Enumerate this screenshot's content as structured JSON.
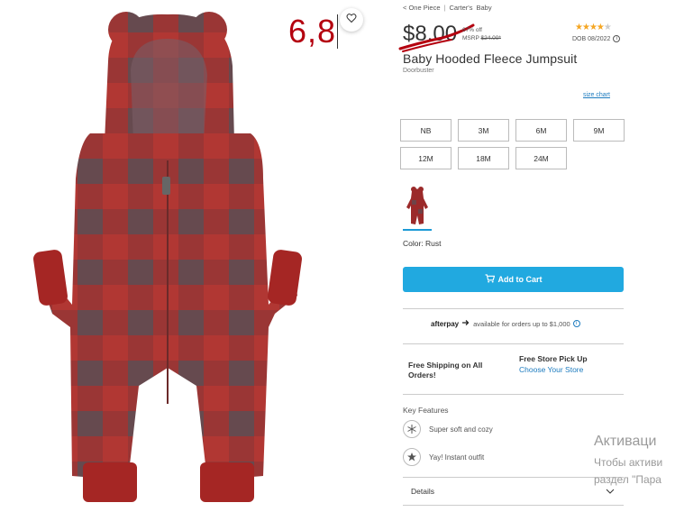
{
  "breadcrumb": [
    "< One Piece",
    "Carter's",
    "Baby"
  ],
  "annotation": {
    "handwritten_price": "6,8"
  },
  "price": {
    "sale": "$8.00",
    "percent_off": "67% off",
    "msrp_label": "MSRP",
    "msrp_value": "$24.00*"
  },
  "rating": {
    "stars_value": 4,
    "stars_max": 5,
    "dob": "DOB 08/2022"
  },
  "product": {
    "title": "Baby Hooded Fleece Jumpsuit",
    "subtitle": "Doorbuster"
  },
  "size_chart_label": "size chart",
  "sizes": [
    "NB",
    "3M",
    "6M",
    "9M",
    "12M",
    "18M",
    "24M"
  ],
  "color": {
    "label": "Color: Rust",
    "swatch": "#9b2a2a"
  },
  "cart": {
    "label": "Add to Cart"
  },
  "afterpay": {
    "brand": "afterpay",
    "text": "available for orders up to $1,000"
  },
  "shipping": {
    "free_shipping": "Free Shipping on All Orders!",
    "pickup_title": "Free Store Pick Up",
    "pickup_link": "Choose Your Store"
  },
  "features": {
    "heading": "Key Features",
    "items": [
      "Super soft and cozy",
      "Yay! Instant outfit"
    ]
  },
  "details": {
    "label": "Details"
  },
  "windows_watermark": {
    "line1": "Активаци",
    "line2": "Чтобы активи",
    "line3": "раздел \"Пара"
  },
  "colors": {
    "accent": "#21a9e0",
    "link": "#1c7bbf",
    "annotation_red": "#b4000f",
    "star": "#f5a623"
  }
}
